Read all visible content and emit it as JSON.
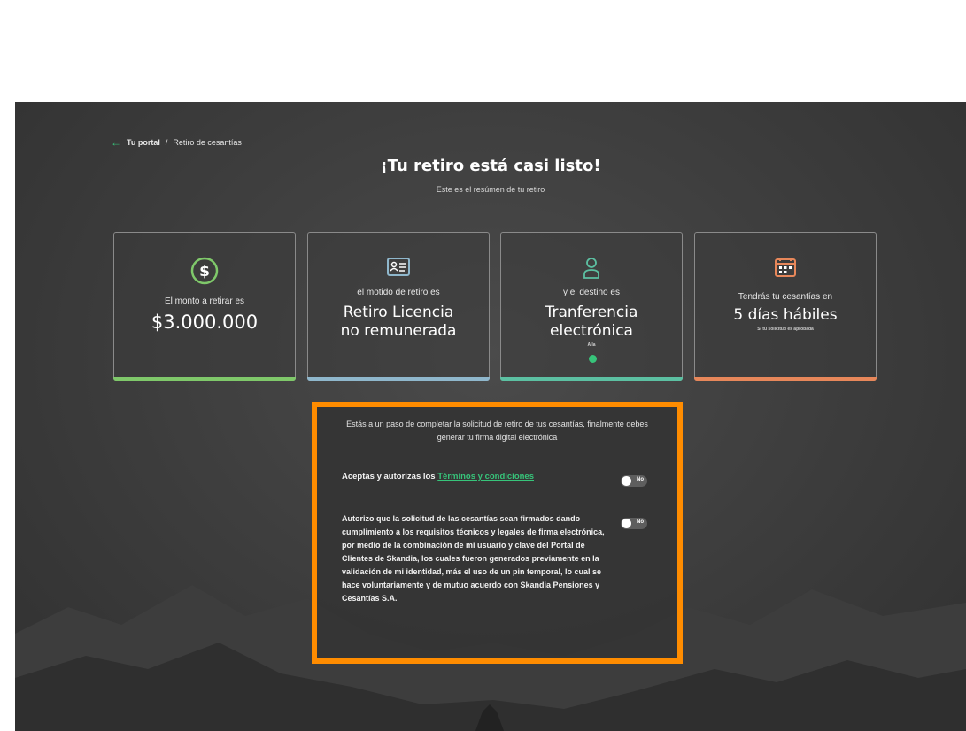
{
  "breadcrumb": {
    "portal": "Tu portal",
    "separator": "/",
    "current": "Retiro de cesantías"
  },
  "header": {
    "title": "¡Tu retiro está casi listo!",
    "subtitle": "Este es el resúmen de tu retiro"
  },
  "cards": [
    {
      "label": "El monto a retirar es",
      "value": "$3.000.000",
      "icon": "dollar-circle-icon",
      "accent": "#7fc86a"
    },
    {
      "label": "el motido de retiro es",
      "value_line1": "Retiro Licencia",
      "value_line2": "no remunerada",
      "icon": "id-card-icon",
      "accent": "#8fb7cc"
    },
    {
      "label": "y el destino es",
      "value_line1": "Tranferencia",
      "value_line2": "electrónica",
      "note": "A la",
      "icon": "person-icon",
      "accent": "#5cc0a2"
    },
    {
      "label": "Tendrás tu cesantías en",
      "value": "5 días hábiles",
      "note": "Si tu solicitud es aprobada",
      "icon": "calendar-icon",
      "accent": "#e7875a"
    }
  ],
  "panel": {
    "intro": "Estás a un paso de completar la solicitud de retiro de tus cesantías, finalmente debes generar tu firma digital electrónica",
    "accept_prefix": "Aceptas y autorizas los",
    "terms_link": "Términos y condiciones",
    "toggle1_label": "No",
    "toggle2_label": "No",
    "authorization_text": "Autorizo que la solicitud de las cesantías sean firmados dando cumplimiento a los requisitos técnicos y legales de firma electrónica, por medio de la combinación de mi usuario y clave del Portal de Clientes de Skandia, los cuales fueron generados previamente en la validación de mi identidad, más el uso de un pin temporal, lo cual se hace voluntariamente y de mutuo acuerdo con Skandia Pensiones y Cesantías S.A."
  },
  "colors": {
    "highlight_border": "#ff8c00",
    "brand_green": "#37c47a"
  }
}
